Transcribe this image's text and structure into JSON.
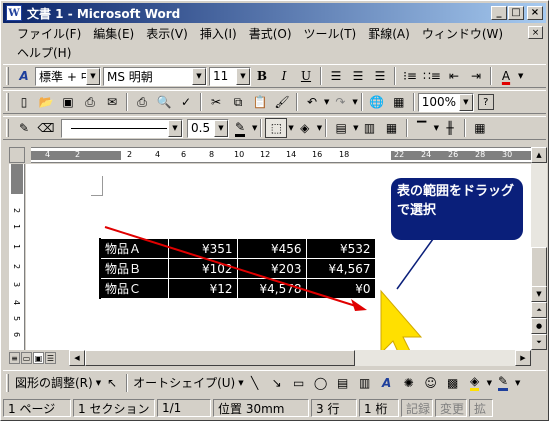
{
  "window": {
    "title": "文書 1 - Microsoft Word",
    "app_icon": "W",
    "controls": [
      "_",
      "□",
      "×"
    ]
  },
  "menu": {
    "row1": [
      "ファイル(F)",
      "編集(E)",
      "表示(V)",
      "挿入(I)",
      "書式(O)",
      "ツール(T)",
      "罫線(A)",
      "ウィンドウ(W)"
    ],
    "row2": [
      "ヘルプ(H)"
    ],
    "doc_controls": [
      "×"
    ]
  },
  "format_toolbar": {
    "style": "標準 + 中・",
    "font": "MS 明朝",
    "size": "11",
    "bold": "B",
    "italic": "I",
    "underline": "U"
  },
  "standard_toolbar": {
    "zoom": "100%",
    "help": "?"
  },
  "lines_toolbar": {
    "line_weight": "0.5"
  },
  "ruler": {
    "ticks": [
      "4",
      "2",
      "2",
      "4",
      "6",
      "8",
      "10",
      "12",
      "14",
      "16",
      "18",
      "22",
      "24",
      "26",
      "28",
      "30"
    ],
    "vticks": [
      "2",
      "1",
      "1",
      "2",
      "3",
      "4",
      "5",
      "6"
    ]
  },
  "table": {
    "rows": [
      {
        "name": "物品Ａ",
        "values": [
          "¥351",
          "¥456",
          "¥532"
        ]
      },
      {
        "name": "物品Ｂ",
        "values": [
          "¥102",
          "¥203",
          "¥4,567"
        ]
      },
      {
        "name": "物品Ｃ",
        "values": [
          "¥12",
          "¥4,578",
          "¥0"
        ]
      }
    ]
  },
  "callout": {
    "text": "表の範囲をドラッグで選択"
  },
  "draw_toolbar": {
    "adjust": "図形の調整(R)",
    "autoshapes": "オートシェイプ(U)"
  },
  "status": {
    "page": "1 ページ",
    "section": "1 セクション",
    "page_of": "1/1",
    "position": "位置 30mm",
    "line": "3 行",
    "column": "1 桁",
    "rec": "記録",
    "trk": "変更",
    "ext": "拡"
  },
  "colors": {
    "title_start": "#0a246a",
    "title_end": "#a6caf0",
    "callout": "#0a1f7a",
    "arrow_red": "#e00000",
    "cursor_yellow": "#ffe000"
  }
}
